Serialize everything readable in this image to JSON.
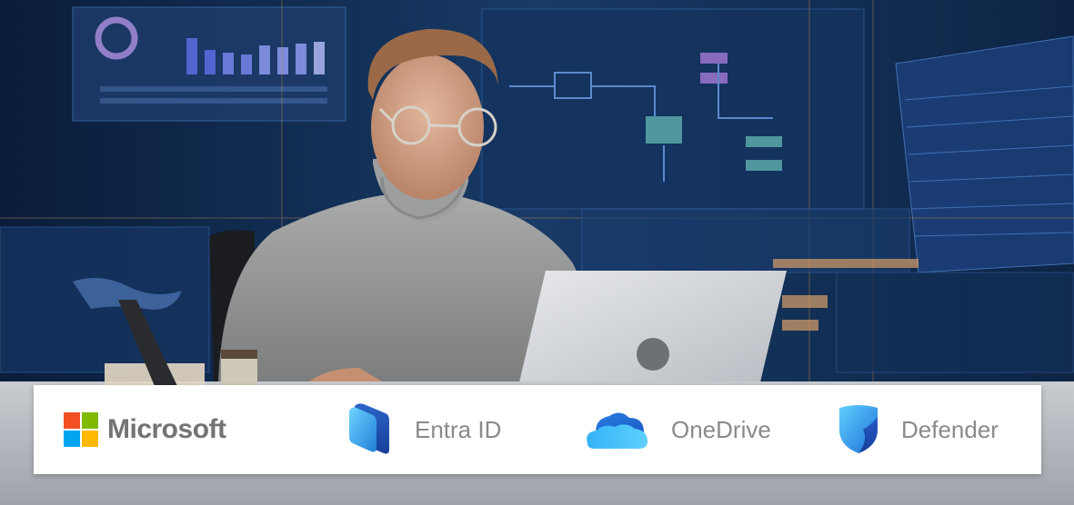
{
  "brands": {
    "microsoft": {
      "name": "Microsoft",
      "colors": [
        "#f25022",
        "#7fba00",
        "#00a4ef",
        "#ffb900"
      ]
    },
    "entra": {
      "label": "Entra ID",
      "icon": "entra-id-icon"
    },
    "onedrive": {
      "label": "OneDrive",
      "icon": "onedrive-cloud-icon"
    },
    "defender": {
      "label": "Defender",
      "icon": "defender-shield-icon"
    }
  },
  "colors": {
    "label_gray": "#8a8a8a",
    "bar_bg": "#ffffff"
  }
}
